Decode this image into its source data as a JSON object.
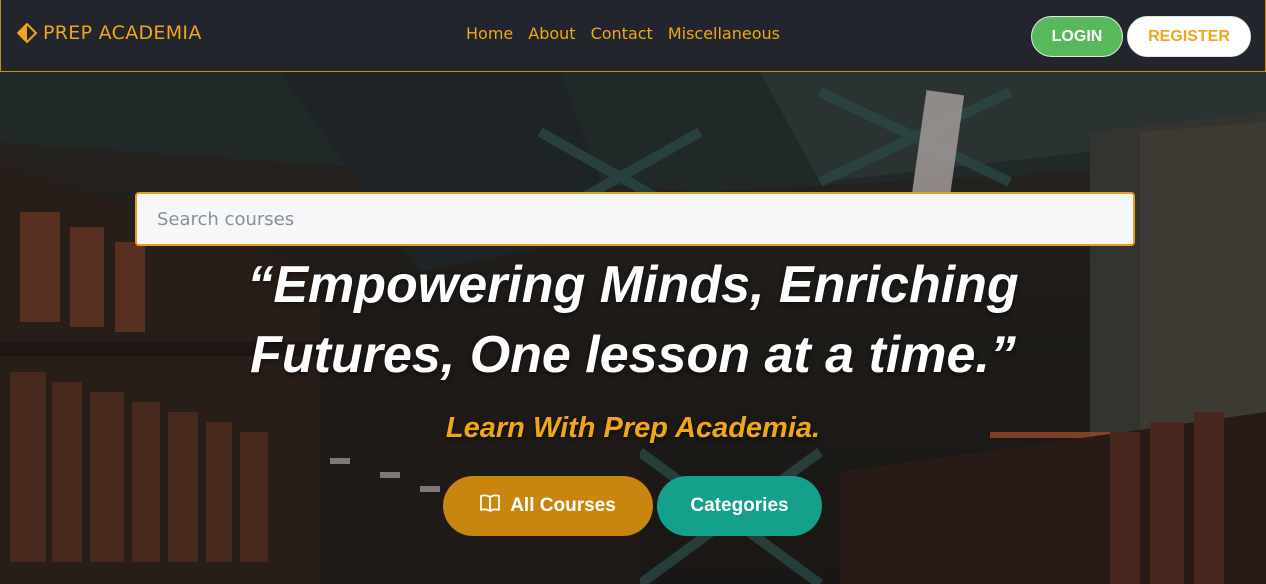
{
  "navbar": {
    "brand": "PREP ACADEMIA",
    "links": [
      "Home",
      "About",
      "Contact",
      "Miscellaneous"
    ],
    "login_label": "LOGIN",
    "register_label": "REGISTER"
  },
  "hero": {
    "search_placeholder": "Search courses",
    "quote": "“Empowering Minds, Enriching Futures, One lesson at a time.”",
    "tagline": "Learn With Prep Academia.",
    "all_courses_label": "All Courses",
    "categories_label": "Categories"
  },
  "colors": {
    "accent": "#f0a61a",
    "navbar_bg": "#22252b",
    "login_bg": "#58b85c",
    "courses_bg": "#c8850f",
    "categories_bg": "#15a08c"
  },
  "icons": {
    "brand": "diamond-arrow-icon",
    "courses": "book-open-icon"
  }
}
